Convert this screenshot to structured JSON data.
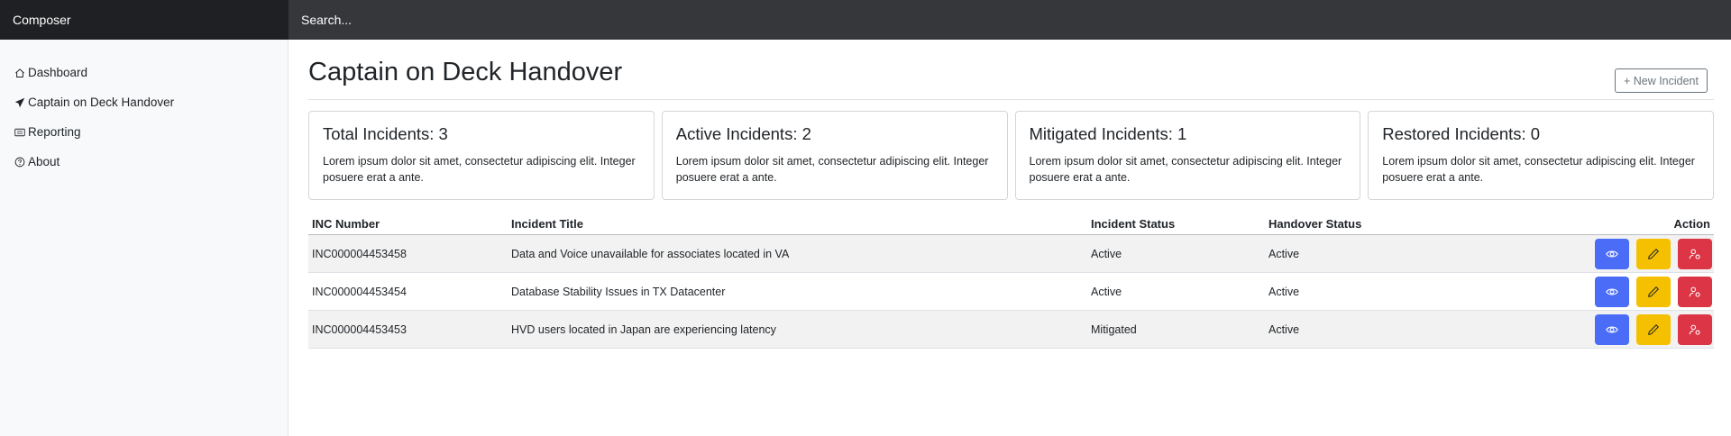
{
  "topbar": {
    "brand": "Composer",
    "search_placeholder": "Search..."
  },
  "sidebar": {
    "items": [
      {
        "label": "Dashboard",
        "icon": "house-icon"
      },
      {
        "label": "Captain on Deck Handover",
        "icon": "send-icon"
      },
      {
        "label": "Reporting",
        "icon": "list-card-icon"
      },
      {
        "label": "About",
        "icon": "question-circle-icon"
      }
    ]
  },
  "page": {
    "title": "Captain on Deck Handover",
    "new_button": "+ New Incident"
  },
  "cards": [
    {
      "title": "Total Incidents: 3",
      "text": "Lorem ipsum dolor sit amet, consectetur adipiscing elit. Integer posuere erat a ante."
    },
    {
      "title": "Active Incidents: 2",
      "text": "Lorem ipsum dolor sit amet, consectetur adipiscing elit. Integer posuere erat a ante."
    },
    {
      "title": "Mitigated Incidents: 1",
      "text": "Lorem ipsum dolor sit amet, consectetur adipiscing elit. Integer posuere erat a ante."
    },
    {
      "title": "Restored Incidents: 0",
      "text": "Lorem ipsum dolor sit amet, consectetur adipiscing elit. Integer posuere erat a ante."
    }
  ],
  "table": {
    "headers": [
      "INC Number",
      "Incident Title",
      "Incident Status",
      "Handover Status",
      "Action"
    ],
    "rows": [
      {
        "inc": "INC000004453458",
        "title": "Data and Voice unavailable for associates located in VA",
        "incident_status": "Active",
        "handover_status": "Active"
      },
      {
        "inc": "INC000004453454",
        "title": "Database Stability Issues in TX Datacenter",
        "incident_status": "Active",
        "handover_status": "Active"
      },
      {
        "inc": "INC000004453453",
        "title": "HVD users located in Japan are experiencing latency",
        "incident_status": "Mitigated",
        "handover_status": "Active"
      }
    ],
    "action_icons": [
      "eye-icon",
      "pencil-icon",
      "person-gear-icon"
    ]
  },
  "colors": {
    "view": "#4a6cf7",
    "edit": "#f5c000",
    "assign": "#dc3545",
    "brand_bg": "#1f2023",
    "search_bg": "#36373b"
  }
}
